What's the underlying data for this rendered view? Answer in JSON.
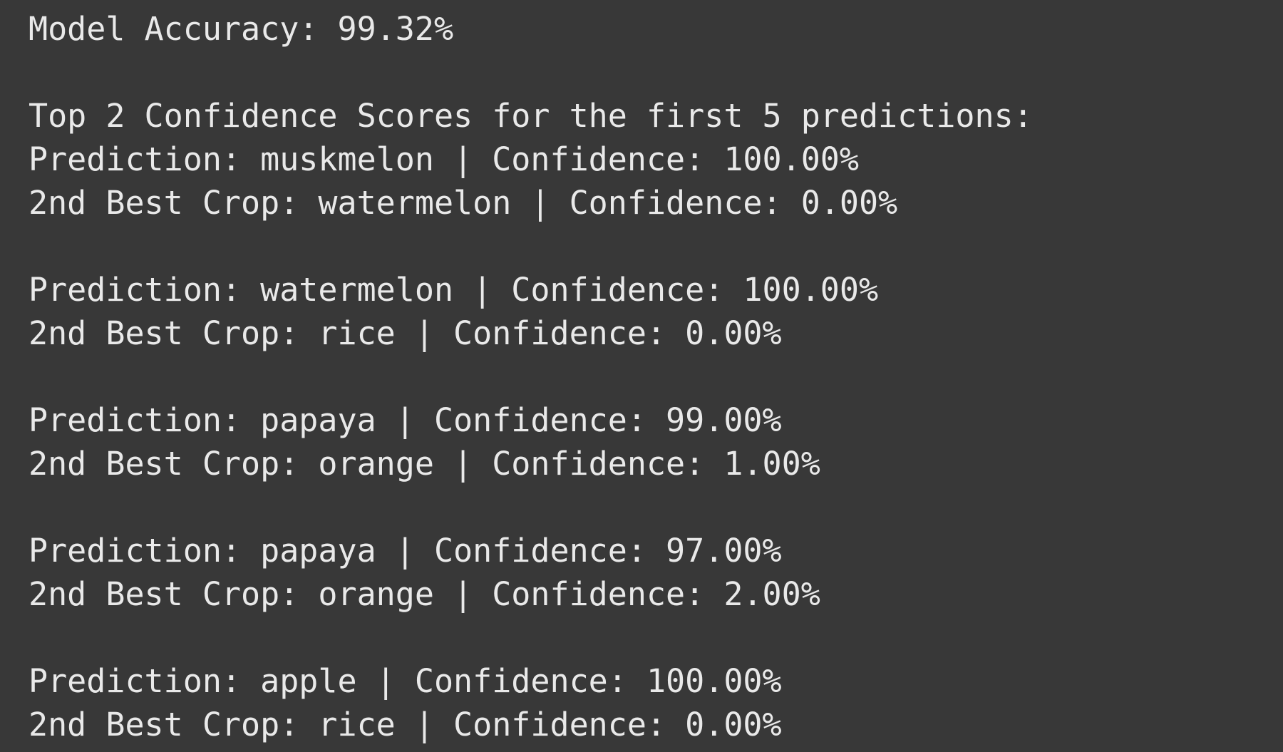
{
  "output": {
    "accuracy_line": "Model Accuracy: 99.32%",
    "header_line": "Top 2 Confidence Scores for the first 5 predictions:",
    "predictions": [
      {
        "prediction_line": "Prediction: muskmelon | Confidence: 100.00%",
        "second_line": "2nd Best Crop: watermelon | Confidence: 0.00%"
      },
      {
        "prediction_line": "Prediction: watermelon | Confidence: 100.00%",
        "second_line": "2nd Best Crop: rice | Confidence: 0.00%"
      },
      {
        "prediction_line": "Prediction: papaya | Confidence: 99.00%",
        "second_line": "2nd Best Crop: orange | Confidence: 1.00%"
      },
      {
        "prediction_line": "Prediction: papaya | Confidence: 97.00%",
        "second_line": "2nd Best Crop: orange | Confidence: 2.00%"
      },
      {
        "prediction_line": "Prediction: apple | Confidence: 100.00%",
        "second_line": "2nd Best Crop: rice | Confidence: 0.00%"
      }
    ]
  },
  "colors": {
    "background": "#383838",
    "text": "#e9e9e9"
  }
}
